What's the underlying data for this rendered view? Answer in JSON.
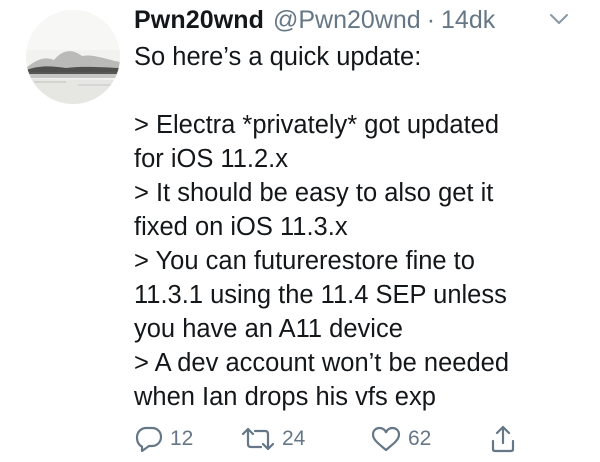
{
  "tweet": {
    "display_name": "Pwn20wnd",
    "handle": "@Pwn20wnd",
    "separator": "·",
    "time": "14dk",
    "lines": [
      "So here’s a quick update:",
      "",
      "> Electra *privately* got updated",
      "for iOS 11.2.x",
      "> It should be easy to also get it",
      "fixed on iOS 11.3.x",
      "> You can futurerestore fine to",
      "11.3.1 using the 11.4 SEP unless",
      "you have an A11 device",
      "> A dev account won’t be needed",
      "when Ian drops his vfs exp"
    ]
  },
  "actions": {
    "reply": {
      "icon": "reply-icon",
      "count": "12"
    },
    "retweet": {
      "icon": "retweet-icon",
      "count": "24"
    },
    "like": {
      "icon": "heart-icon",
      "count": "62"
    },
    "share": {
      "icon": "share-icon"
    }
  },
  "colors": {
    "text": "#14171a",
    "muted": "#657786",
    "background": "#ffffff"
  }
}
